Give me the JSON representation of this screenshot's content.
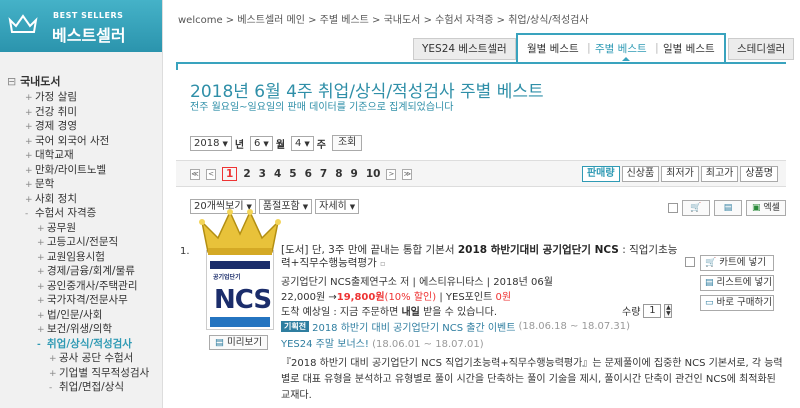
{
  "logo": {
    "tag": "BEST SELLERS",
    "title": "베스트셀러"
  },
  "breadcrumb": "welcome > 베스트셀러 메인 > 주별 베스트 > 국내도서 > 수험서 자격증 > 취업/상식/적성검사",
  "tabs": {
    "yes24": "YES24 베스트셀러",
    "monthly": "월별 베스트",
    "weekly": "주별 베스트",
    "daily": "일별 베스트",
    "steady": "스테디셀러"
  },
  "sidebar": {
    "title": "국내도서",
    "items": [
      {
        "pm": "+",
        "label": "가정 살림"
      },
      {
        "pm": "+",
        "label": "건강 취미"
      },
      {
        "pm": "+",
        "label": "경제 경영"
      },
      {
        "pm": "+",
        "label": "국어 외국어 사전"
      },
      {
        "pm": "+",
        "label": "대학교재"
      },
      {
        "pm": "+",
        "label": "만화/라이트노벨"
      },
      {
        "pm": "+",
        "label": "문학"
      },
      {
        "pm": "+",
        "label": "사회 정치"
      },
      {
        "pm": "-",
        "label": "수험서 자격증"
      },
      {
        "pm": "+",
        "label": "공무원"
      },
      {
        "pm": "+",
        "label": "고등고시/전문직"
      },
      {
        "pm": "+",
        "label": "교원임용시험"
      },
      {
        "pm": "+",
        "label": "경제/금융/회계/물류"
      },
      {
        "pm": "+",
        "label": "공인중개사/주택관리"
      },
      {
        "pm": "+",
        "label": "국가자격/전문사무"
      },
      {
        "pm": "+",
        "label": "법/인문/사회"
      },
      {
        "pm": "+",
        "label": "보건/위생/의학"
      },
      {
        "pm": "-",
        "label": "취업/상식/적성검사"
      },
      {
        "pm": "+",
        "label": "공사 공단 수험서"
      },
      {
        "pm": "+",
        "label": "기업별 직무적성검사"
      },
      {
        "pm": "-",
        "label": "취업/면접/상식"
      }
    ]
  },
  "heading": {
    "title": "2018년 6월 4주 취업/상식/적성검사 주별 베스트",
    "subtitle": "전주 월요일~일요일의 판매 데이터를 기준으로 집계되었습니다"
  },
  "date_selector": {
    "year": "2018",
    "year_unit": "년",
    "month": "6",
    "month_unit": "월",
    "week": "4",
    "week_unit": "주",
    "query": "조회"
  },
  "pager": {
    "first": "≪",
    "prev": "<",
    "current": "1",
    "pages": [
      "2",
      "3",
      "4",
      "5",
      "6",
      "7",
      "8",
      "9",
      "10"
    ],
    "next": ">",
    "last": "≫"
  },
  "sort": [
    "판매량",
    "신상품",
    "최저가",
    "최고가",
    "상품명"
  ],
  "view": {
    "count": "20개씩보기",
    "filter": "품절포함",
    "detail": "자세히",
    "excel": "엑셀"
  },
  "item": {
    "rank": "1.",
    "title_prefix": "[도서] 단, 3주 만에 끝내는 통합 기본서",
    "title_bold": "2018 하반기대비 공기업단기 NCS",
    "title_suffix": ": 직업기초능력+직무수행능력평가",
    "cover": {
      "line1": "공기업단기",
      "big": "NCS"
    },
    "publisher": "공기업단기 NCS출제연구소 저 | 에스티유니타스 | 2018년 06월",
    "price": "22,000원 →",
    "sale_price": "19,800원",
    "discount": "(10% 할인)",
    "point_label": "| YES포인트",
    "point": "0원",
    "ship": "도착 예상일 : 지금 주문하면",
    "ship_bold": "내일",
    "ship_tail": "받을 수 있습니다.",
    "event_tag": "기획전",
    "event": "2018 하반기 대비 공기업단기 NCS 출간 이벤트",
    "event_date": "(18.06.18 ~ 18.07.31)",
    "weekend": "YES24 주말 보너스!",
    "weekend_date": "(18.06.01 ~ 18.07.01)",
    "qty_label": "수량",
    "qty": "1",
    "preview": "미리보기",
    "cart": "카트에 넣기",
    "list": "리스트에 넣기",
    "buy": "바로 구매하기",
    "description": "『2018 하반기 대비 공기업단기 NCS 직업기초능력+직무수행능력평가』는 문제풀이에 집중한 NCS 기본서로, 각 능력별로 대표 유형을 분석하고 유형별로 풀이 시간을 단축하는 풀이 기술을 제시, 풀이시간 단축이 관건인 NCS에 최적화된 교재다."
  },
  "colors": {
    "accent": "#39a3be",
    "sale": "#e33333",
    "link": "#2f7ea0"
  }
}
